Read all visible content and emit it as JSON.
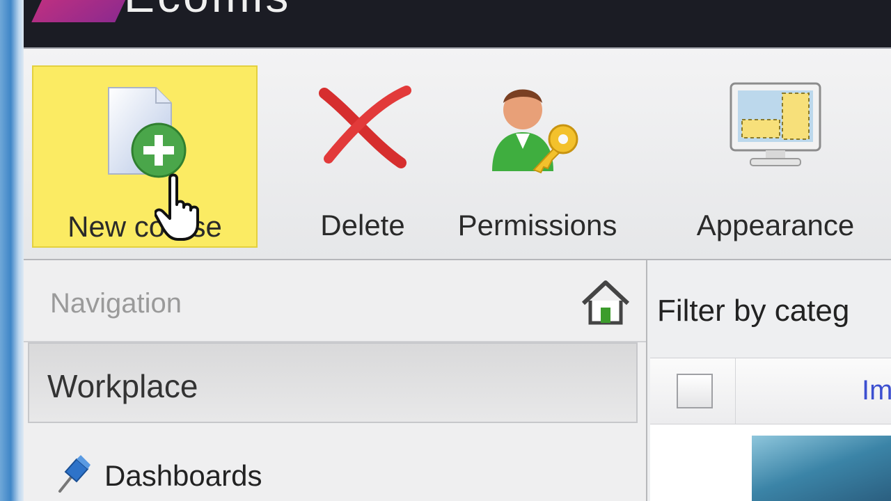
{
  "app": {
    "brand": "Ecomis"
  },
  "toolbar": {
    "buttons": [
      {
        "id": "new-course",
        "label": "New course",
        "icon": "new-document-plus-icon",
        "highlighted": true
      },
      {
        "id": "delete",
        "label": "Delete",
        "icon": "red-x-icon"
      },
      {
        "id": "permissions",
        "label": "Permissions",
        "icon": "user-key-icon"
      },
      {
        "id": "appearance",
        "label": "Appearance",
        "icon": "monitor-layout-icon"
      }
    ]
  },
  "navigation": {
    "title": "Navigation",
    "home_icon": "home-icon",
    "section": "Workplace",
    "items": [
      {
        "label": "Dashboards",
        "icon": "pushpin-icon"
      }
    ]
  },
  "content": {
    "filter_label": "Filter by categ",
    "column_header": "Im"
  },
  "colors": {
    "header_bg": "#1b1c24",
    "highlight": "#fbeb63",
    "link": "#3c4fd0"
  }
}
